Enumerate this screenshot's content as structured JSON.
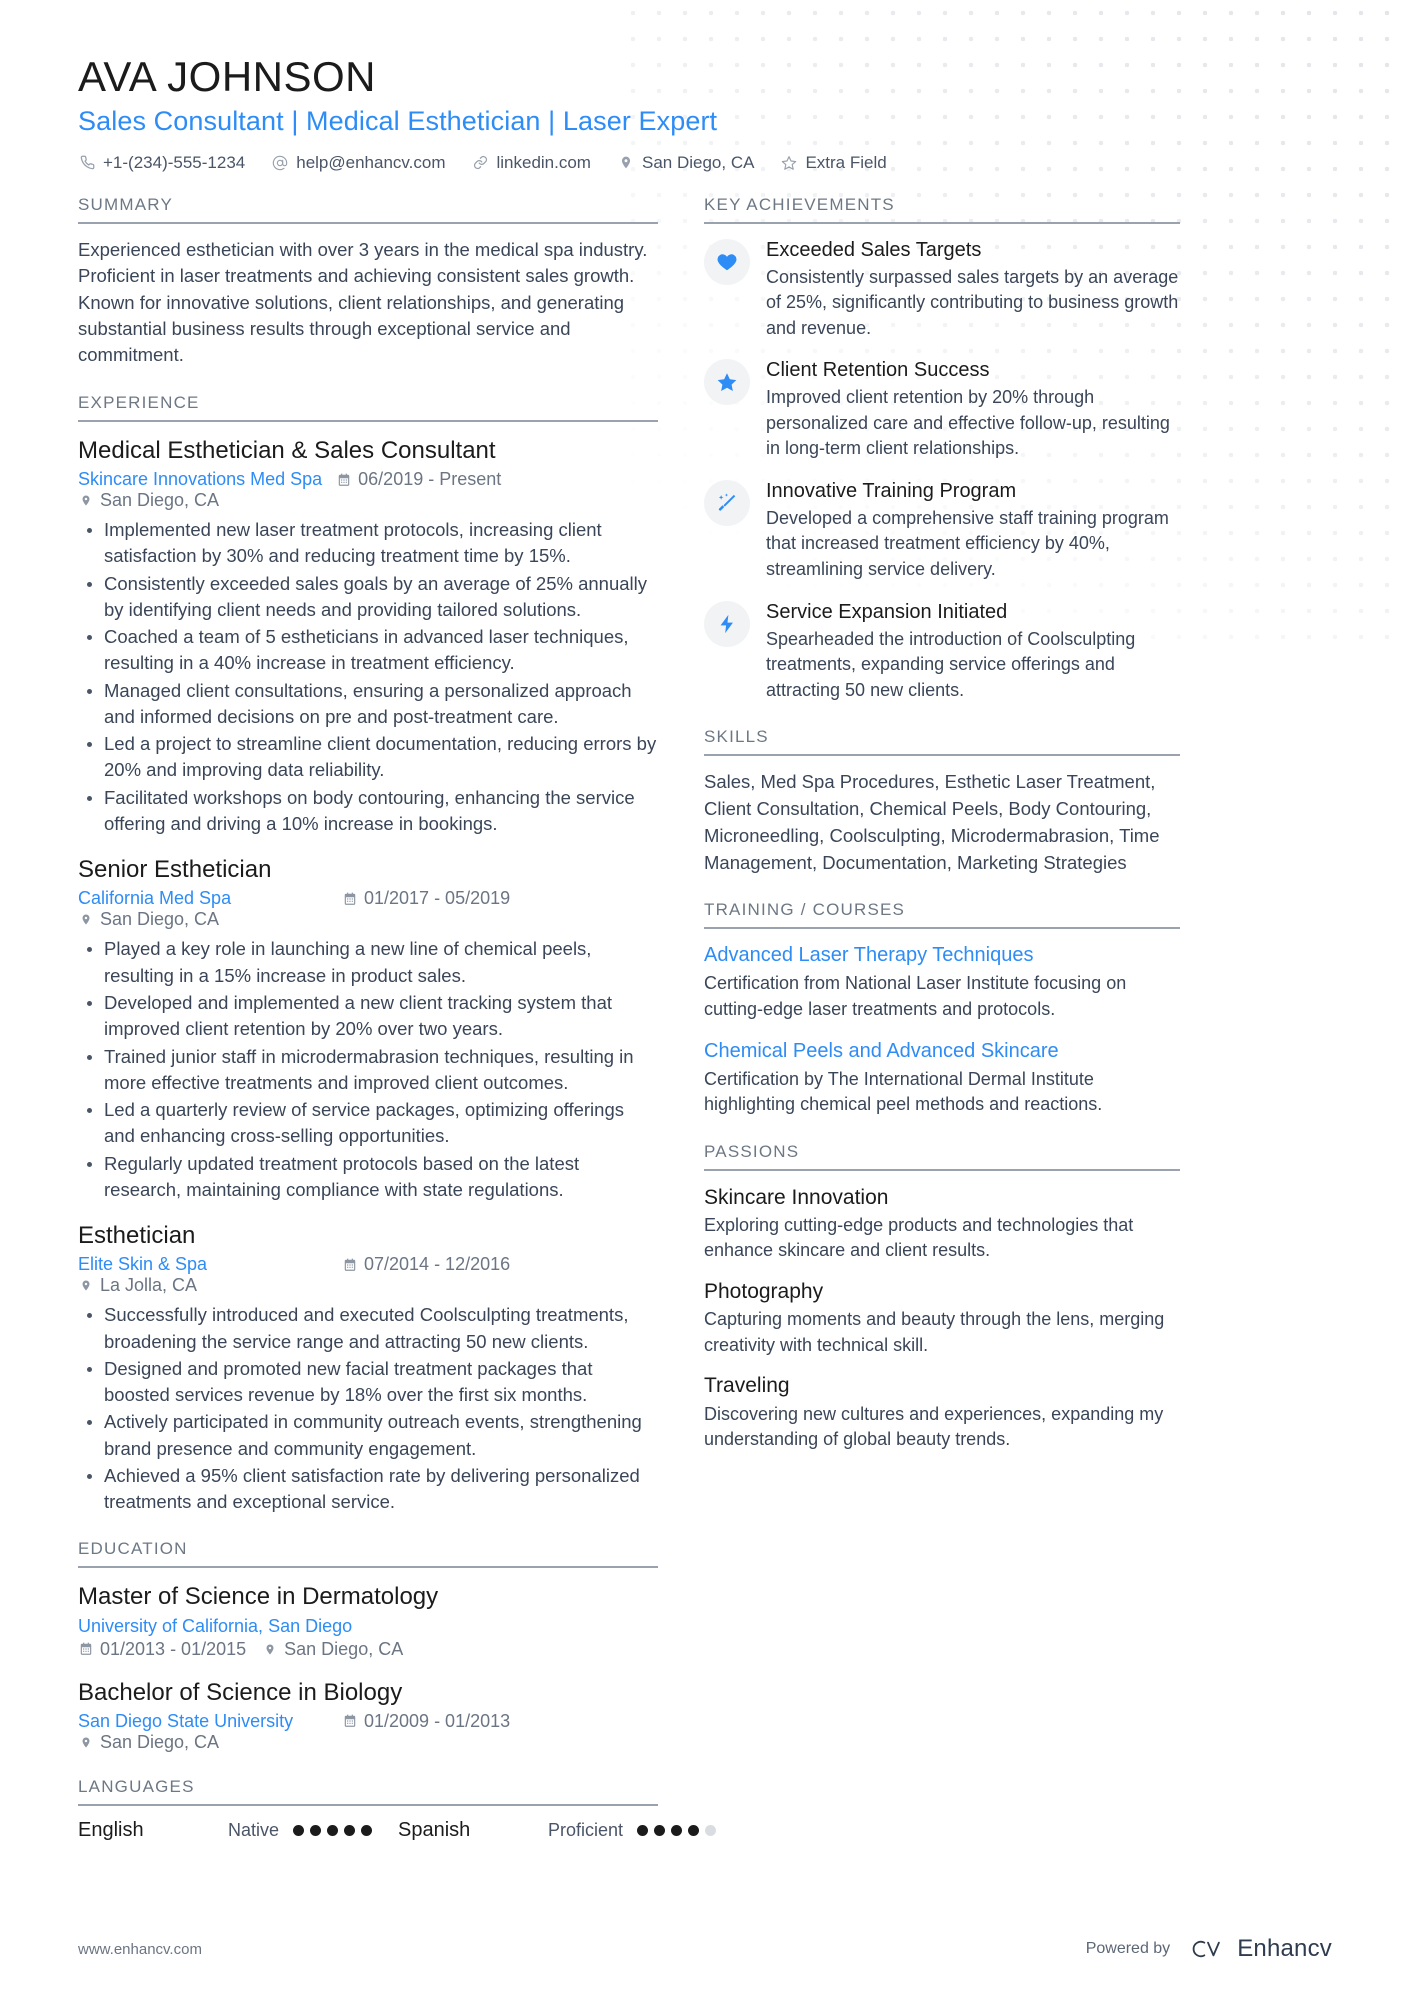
{
  "header": {
    "name": "AVA JOHNSON",
    "headline": "Sales Consultant | Medical Esthetician | Laser Expert",
    "contacts": [
      {
        "icon": "phone-icon",
        "text": "+1-(234)-555-1234"
      },
      {
        "icon": "email-icon",
        "text": "help@enhancv.com"
      },
      {
        "icon": "link-icon",
        "text": "linkedin.com"
      },
      {
        "icon": "location-icon",
        "text": "San Diego, CA"
      },
      {
        "icon": "star-icon",
        "text": "Extra Field"
      }
    ]
  },
  "summary": {
    "title": "SUMMARY",
    "text": "Experienced esthetician with over 3 years in the medical spa industry. Proficient in laser treatments and achieving consistent sales growth. Known for innovative solutions, client relationships, and generating substantial business results through exceptional service and commitment."
  },
  "experience": {
    "title": "EXPERIENCE",
    "entries": [
      {
        "role": "Medical Esthetician & Sales Consultant",
        "org": "Skincare Innovations Med Spa",
        "dates": "06/2019 - Present",
        "location": "San Diego, CA",
        "bullets": [
          "Implemented new laser treatment protocols, increasing client satisfaction by 30% and reducing treatment time by 15%.",
          "Consistently exceeded sales goals by an average of 25% annually by identifying client needs and providing tailored solutions.",
          "Coached a team of 5 estheticians in advanced laser techniques, resulting in a 40% increase in treatment efficiency.",
          "Managed client consultations, ensuring a personalized approach and informed decisions on pre and post-treatment care.",
          "Led a project to streamline client documentation, reducing errors by 20% and improving data reliability.",
          "Facilitated workshops on body contouring, enhancing the service offering and driving a 10% increase in bookings."
        ]
      },
      {
        "role": "Senior Esthetician",
        "org": "California Med Spa",
        "dates": "01/2017 - 05/2019",
        "location": "San Diego, CA",
        "bullets": [
          "Played a key role in launching a new line of chemical peels, resulting in a 15% increase in product sales.",
          "Developed and implemented a new client tracking system that improved client retention by 20% over two years.",
          "Trained junior staff in microdermabrasion techniques, resulting in more effective treatments and improved client outcomes.",
          "Led a quarterly review of service packages, optimizing offerings and enhancing cross-selling opportunities.",
          "Regularly updated treatment protocols based on the latest research, maintaining compliance with state regulations."
        ]
      },
      {
        "role": "Esthetician",
        "org": "Elite Skin & Spa",
        "dates": "07/2014 - 12/2016",
        "location": "La Jolla, CA",
        "bullets": [
          "Successfully introduced and executed Coolsculpting treatments, broadening the service range and attracting 50 new clients.",
          "Designed and promoted new facial treatment packages that boosted services revenue by 18% over the first six months.",
          "Actively participated in community outreach events, strengthening brand presence and community engagement.",
          "Achieved a 95% client satisfaction rate by delivering personalized treatments and exceptional service."
        ]
      }
    ]
  },
  "education": {
    "title": "EDUCATION",
    "entries": [
      {
        "degree": "Master of Science in Dermatology",
        "org": "University of California, San Diego",
        "dates": "01/2013 - 01/2015",
        "location": "San Diego, CA",
        "org_inline": false
      },
      {
        "degree": "Bachelor of Science in Biology",
        "org": "San Diego State University",
        "dates": "01/2009 - 01/2013",
        "location": "San Diego, CA",
        "org_inline": true
      }
    ]
  },
  "languages": {
    "title": "LANGUAGES",
    "items": [
      {
        "name": "English",
        "level": "Native",
        "filled": 5,
        "total": 5
      },
      {
        "name": "Spanish",
        "level": "Proficient",
        "filled": 4,
        "total": 5
      }
    ]
  },
  "achievements": {
    "title": "KEY ACHIEVEMENTS",
    "items": [
      {
        "icon": "heart-icon",
        "title": "Exceeded Sales Targets",
        "desc": "Consistently surpassed sales targets by an average of 25%, significantly contributing to business growth and revenue."
      },
      {
        "icon": "star-filled-icon",
        "title": "Client Retention Success",
        "desc": "Improved client retention by 20% through personalized care and effective follow-up, resulting in long-term client relationships."
      },
      {
        "icon": "magic-wand-icon",
        "title": "Innovative Training Program",
        "desc": "Developed a comprehensive staff training program that increased treatment efficiency by 40%, streamlining service delivery."
      },
      {
        "icon": "bolt-icon",
        "title": "Service Expansion Initiated",
        "desc": "Spearheaded the introduction of Coolsculpting treatments, expanding service offerings and attracting 50 new clients."
      }
    ]
  },
  "skills": {
    "title": "SKILLS",
    "text": "Sales, Med Spa Procedures, Esthetic Laser Treatment, Client Consultation, Chemical Peels, Body Contouring, Microneedling, Coolsculpting, Microdermabrasion, Time Management, Documentation, Marketing Strategies"
  },
  "training": {
    "title": "TRAINING / COURSES",
    "items": [
      {
        "title": "Advanced Laser Therapy Techniques",
        "desc": "Certification from National Laser Institute focusing on cutting-edge laser treatments and protocols."
      },
      {
        "title": "Chemical Peels and Advanced Skincare",
        "desc": "Certification by The International Dermal Institute highlighting chemical peel methods and reactions."
      }
    ]
  },
  "passions": {
    "title": "PASSIONS",
    "items": [
      {
        "title": "Skincare Innovation",
        "desc": "Exploring cutting-edge products and technologies that enhance skincare and client results."
      },
      {
        "title": "Photography",
        "desc": "Capturing moments and beauty through the lens, merging creativity with technical skill."
      },
      {
        "title": "Traveling",
        "desc": "Discovering new cultures and experiences, expanding my understanding of global beauty trends."
      }
    ]
  },
  "footer": {
    "website": "www.enhancv.com",
    "powered_by": "Powered by",
    "brand": "Enhancv"
  },
  "colors": {
    "accent": "#2d8cf5",
    "text": "#3a4658",
    "muted": "#6d7885",
    "rule": "#9aa3ad"
  }
}
